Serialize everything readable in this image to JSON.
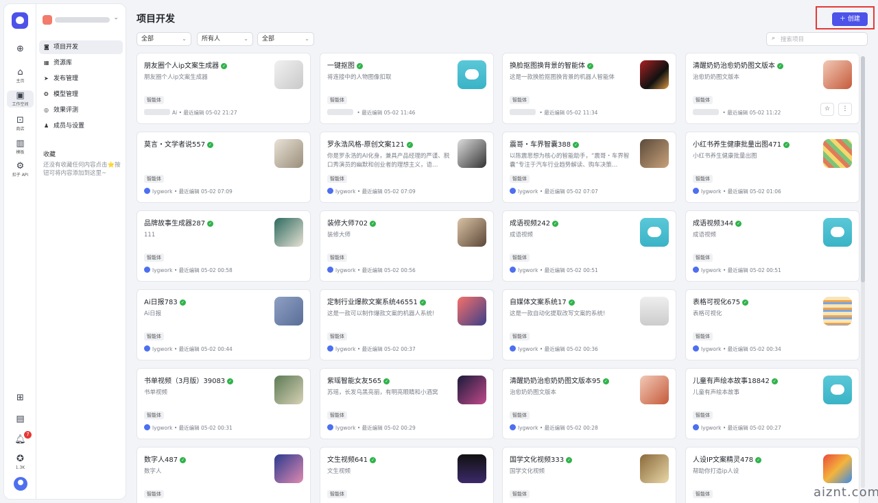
{
  "rail": {
    "items": [
      {
        "icon": "plus-circle-icon",
        "label": ""
      },
      {
        "icon": "home-icon",
        "label": "主页"
      },
      {
        "icon": "terminal-icon",
        "label": "工作空间"
      },
      {
        "icon": "store-icon",
        "label": "商店"
      },
      {
        "icon": "template-icon",
        "label": "模板"
      },
      {
        "icon": "api-icon",
        "label": "扣子 API"
      }
    ],
    "bottom": {
      "badge_count": "7",
      "star_count": "1.3K"
    }
  },
  "workspace": {
    "chevron": "⌄"
  },
  "nav": [
    {
      "icon": "project-icon",
      "label": "项目开发"
    },
    {
      "icon": "library-icon",
      "label": "资源库"
    },
    {
      "icon": "publish-icon",
      "label": "发布管理"
    },
    {
      "icon": "model-icon",
      "label": "模型管理"
    },
    {
      "icon": "eval-icon",
      "label": "效果评测"
    },
    {
      "icon": "members-icon",
      "label": "成员与设置"
    }
  ],
  "favorites": {
    "title": "收藏",
    "empty_text": "还没有收藏任何内容点击⭐按钮可将内容添加到这里~"
  },
  "main": {
    "title": "项目开发",
    "create_label": "创建",
    "filters": [
      "全部",
      "所有人",
      "全部"
    ],
    "search_placeholder": "搜索项目"
  },
  "cards": [
    {
      "name": "朋友圈个人ip文案生成器",
      "desc": "朋友圈个人ip文案生成器",
      "tag": "智能体",
      "author": "Ai",
      "time": "最近编辑 05-02 21:27",
      "thumb": "p1"
    },
    {
      "name": "一键抠图",
      "desc": "将连接中的人物图像扣取",
      "tag": "智能体",
      "author": "",
      "time": "最近编辑 05-02 11:46",
      "thumb": "bot"
    },
    {
      "name": "换脸抠图换背景的智能体",
      "desc": "这是一款换脸抠图换背景的机器人智能体",
      "tag": "智能体",
      "author": "",
      "time": "最近编辑 05-02 11:34",
      "thumb": "p2"
    },
    {
      "name": "清醒奶奶治愈奶奶图文版本",
      "desc": "治愈奶奶图文版本",
      "tag": "智能体",
      "author": "",
      "time": "最近编辑 05-02 11:22",
      "thumb": "p3"
    },
    {
      "name": "莫言・文学者说557",
      "desc": "",
      "tag": "智能体",
      "author": "lygwork",
      "time": "最近编辑 05-02 07:09",
      "thumb": "p4"
    },
    {
      "name": "罗永浩风格-原创文案121",
      "desc": "你是罗永浩的AI化身，兼具产品经理的严谨、脱口秀演员的幽默和创业者的理想主义，语…",
      "tag": "智能体",
      "author": "lygwork",
      "time": "最近编辑 05-02 07:09",
      "thumb": "p5"
    },
    {
      "name": "震哥・车界智囊388",
      "desc": "以陈震思想为核心的智能助手，“震哥・车界智囊”专注于汽车行业趋势解读、购车决策…",
      "tag": "智能体",
      "author": "lygwork",
      "time": "最近编辑 05-02 07:07",
      "thumb": "p6"
    },
    {
      "name": "小红书养生健康批量出图471",
      "desc": "小红书养生健康批量出图",
      "tag": "智能体",
      "author": "lygwork",
      "time": "最近编辑 05-02 01:06",
      "thumb": "p7"
    },
    {
      "name": "品牌故事生成器287",
      "desc": "111",
      "tag": "智能体",
      "author": "lygwork",
      "time": "最近编辑 05-02 00:58",
      "thumb": "p8"
    },
    {
      "name": "装修大师702",
      "desc": "装修大师",
      "tag": "智能体",
      "author": "lygwork",
      "time": "最近编辑 05-02 00:56",
      "thumb": "p9"
    },
    {
      "name": "成语视频242",
      "desc": "成语视频",
      "tag": "智能体",
      "author": "lygwork",
      "time": "最近编辑 05-02 00:51",
      "thumb": "bot"
    },
    {
      "name": "成语视频344",
      "desc": "成语视频",
      "tag": "智能体",
      "author": "lygwork",
      "time": "最近编辑 05-02 00:51",
      "thumb": "bot"
    },
    {
      "name": "Ai日报783",
      "desc": "Ai日报",
      "tag": "智能体",
      "author": "lygwork",
      "time": "最近编辑 05-02 00:44",
      "thumb": "p10"
    },
    {
      "name": "定制行业爆款文案系统46551",
      "desc": "这是一款可以制作爆款文案的机器人系统!",
      "tag": "智能体",
      "author": "lygwork",
      "time": "最近编辑 05-02 00:37",
      "thumb": "p11"
    },
    {
      "name": "自媒体文案系统17",
      "desc": "这是一款自动化提取改写文案的系统!",
      "tag": "智能体",
      "author": "lygwork",
      "time": "最近编辑 05-02 00:36",
      "thumb": "p12"
    },
    {
      "name": "表格可视化675",
      "desc": "表格可视化",
      "tag": "智能体",
      "author": "lygwork",
      "time": "最近编辑 05-02 00:34",
      "thumb": "p13"
    },
    {
      "name": "书单视频（3月版）39083",
      "desc": "书单视频",
      "tag": "智能体",
      "author": "lygwork",
      "time": "最近编辑 05-02 00:31",
      "thumb": "p14"
    },
    {
      "name": "紫瑶智能女友565",
      "desc": "苏瑶，长发乌黑亮丽，有明亮眼睛和小酒窝",
      "tag": "智能体",
      "author": "lygwork",
      "time": "最近编辑 05-02 00:29",
      "thumb": "p15"
    },
    {
      "name": "清醒奶奶治愈奶奶图文版本95",
      "desc": "治愈奶奶图文版本",
      "tag": "智能体",
      "author": "lygwork",
      "time": "最近编辑 05-02 00:28",
      "thumb": "p3"
    },
    {
      "name": "儿童有声绘本故事18842",
      "desc": "儿童有声绘本故事",
      "tag": "智能体",
      "author": "lygwork",
      "time": "最近编辑 05-02 00:27",
      "thumb": "bot"
    },
    {
      "name": "数字人487",
      "desc": "数字人",
      "tag": "智能体",
      "author": "",
      "time": "",
      "thumb": "p16"
    },
    {
      "name": "文生视频641",
      "desc": "文生视频",
      "tag": "智能体",
      "author": "",
      "time": "",
      "thumb": "p17"
    },
    {
      "name": "国学文化视频333",
      "desc": "国学文化视频",
      "tag": "智能体",
      "author": "",
      "time": "",
      "thumb": "p18"
    },
    {
      "name": "人设IP文案精灵478",
      "desc": "帮助你打造ip人设",
      "tag": "智能体",
      "author": "",
      "time": "",
      "thumb": "p19"
    }
  ],
  "watermark": "aiznt.com"
}
